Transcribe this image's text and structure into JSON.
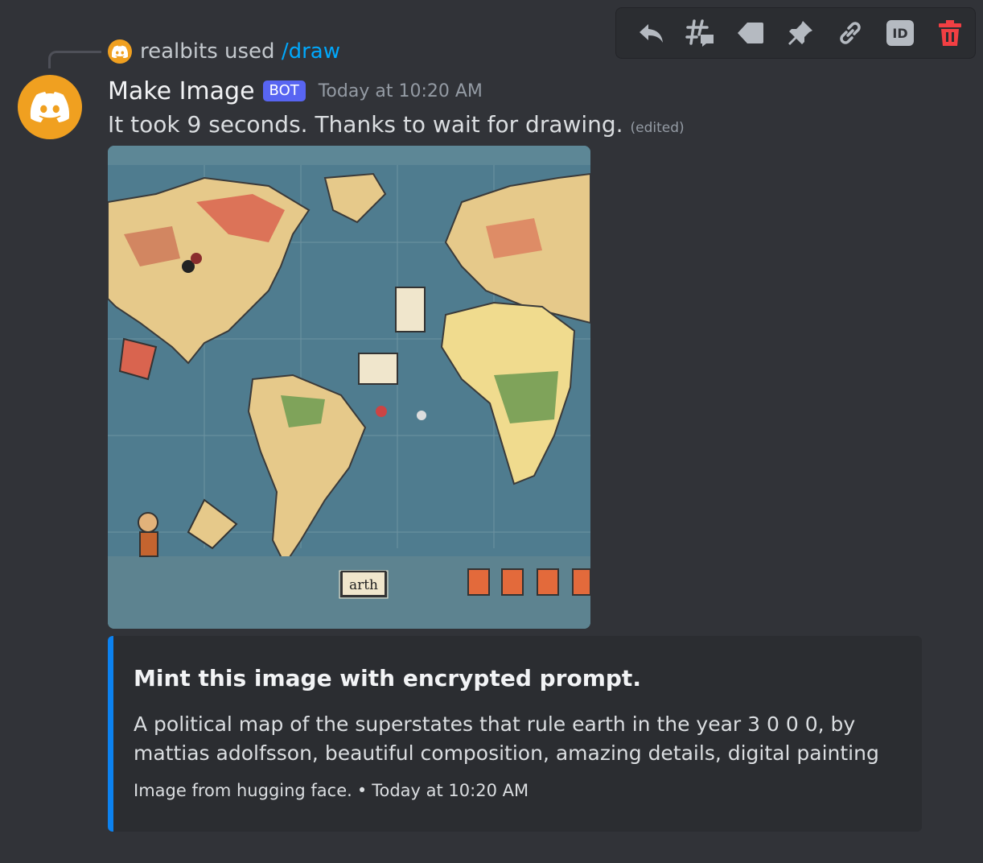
{
  "toolbar": {
    "icons": [
      "reply-icon",
      "create-thread-icon",
      "apps-tag-icon",
      "pin-icon",
      "copy-link-icon",
      "copy-id-icon",
      "delete-icon"
    ],
    "id_label": "ID",
    "colors": {
      "default": "#b5bac1",
      "danger": "#f23f43"
    }
  },
  "reply": {
    "user": "realbits",
    "used": "used",
    "command": "/draw"
  },
  "message": {
    "author": "Make Image",
    "bot_tag": "BOT",
    "timestamp": "Today at 10:20 AM",
    "text": "It took 9 seconds. Thanks to wait for drawing.",
    "edited": "(edited)",
    "avatar_color": "#f0a020"
  },
  "attachment": {
    "map_label": "arth"
  },
  "embed": {
    "title": "Mint this image with encrypted prompt.",
    "description": "A political map of the superstates that rule earth in the year 3 0 0 0, by mattias adolfsson, beautiful composition, amazing details, digital painting",
    "footer_text": "Image from hugging face.",
    "separator": "•",
    "footer_time": "Today at 10:20 AM",
    "accent_color": "#0c82f0"
  }
}
